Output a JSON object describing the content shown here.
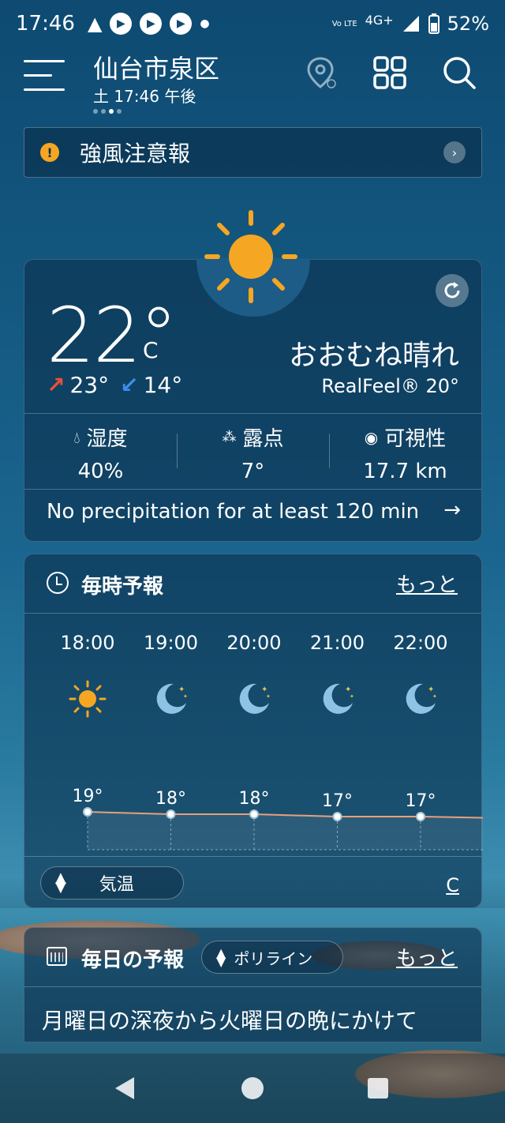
{
  "status_bar": {
    "time": "17:46",
    "network": "4G+",
    "volte": "Vo LTE",
    "battery": "52%"
  },
  "header": {
    "city": "仙台市泉区",
    "subtitle": "土 17:46 午後"
  },
  "alert": {
    "text": "強風注意報"
  },
  "current": {
    "temperature": "22°",
    "unit": "C",
    "high": "23°",
    "low": "14°",
    "condition": "おおむね晴れ",
    "realfeel": "RealFeel® 20°",
    "stats": [
      {
        "label": "湿度",
        "value": "40%"
      },
      {
        "label": "露点",
        "value": "7°"
      },
      {
        "label": "可視性",
        "value": "17.7 km"
      }
    ],
    "precipitation": "No precipitation for at least 120 min"
  },
  "hourly": {
    "title": "毎時予報",
    "more": "もっと",
    "hours": [
      {
        "time": "18:00",
        "icon": "sun-icon",
        "temp": "19°",
        "value": 19
      },
      {
        "time": "19:00",
        "icon": "moon-icon",
        "temp": "18°",
        "value": 18
      },
      {
        "time": "20:00",
        "icon": "moon-icon",
        "temp": "18°",
        "value": 18
      },
      {
        "time": "21:00",
        "icon": "moon-icon",
        "temp": "17°",
        "value": 17
      },
      {
        "time": "22:00",
        "icon": "moon-icon",
        "temp": "17°",
        "value": 17
      }
    ],
    "toggle_label": "気温",
    "unit_label": "C"
  },
  "daily": {
    "title": "毎日の予報",
    "mode_label": "ポリライン",
    "more": "もっと",
    "summary": "月曜日の深夜から火曜日の晩にかけて"
  },
  "colors": {
    "sun": "#f5a623",
    "moon": "#8ec3e6",
    "up_arrow": "#e8503a",
    "down_arrow": "#3a8fe8",
    "line": "#e8a07a"
  }
}
